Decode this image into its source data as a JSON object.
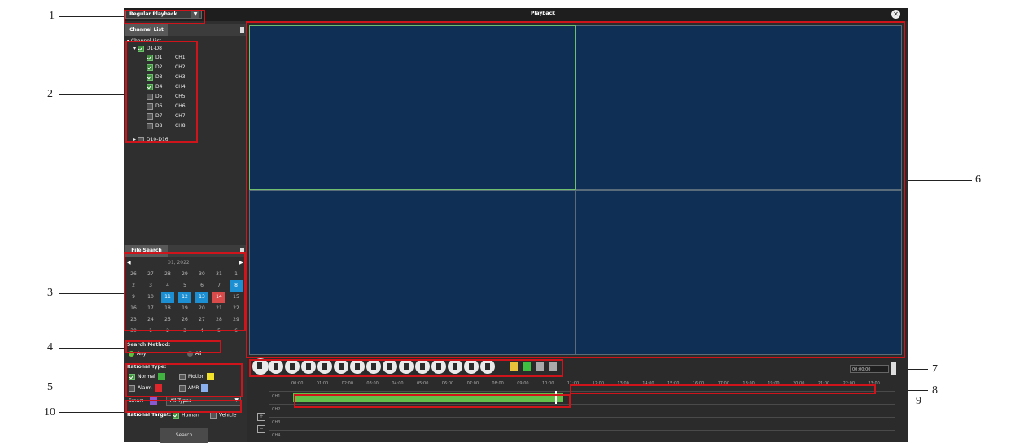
{
  "header": {
    "mode_select": "Regular Playback",
    "title": "Playback",
    "close_icon": "close-icon"
  },
  "sidebar": {
    "channel_tab": "Channel List",
    "tree_root": "Channel List",
    "group_1": "D1-D8",
    "channels": [
      {
        "id": "D1",
        "name": "CH1",
        "checked": true
      },
      {
        "id": "D2",
        "name": "CH2",
        "checked": true
      },
      {
        "id": "D3",
        "name": "CH3",
        "checked": true
      },
      {
        "id": "D4",
        "name": "CH4",
        "checked": true
      },
      {
        "id": "D5",
        "name": "CH5",
        "checked": false
      },
      {
        "id": "D6",
        "name": "CH6",
        "checked": false
      },
      {
        "id": "D7",
        "name": "CH7",
        "checked": false
      },
      {
        "id": "D8",
        "name": "CH8",
        "checked": false
      }
    ],
    "group_2": "D10-D16",
    "file_search_tab": "File Search",
    "calendar": {
      "month_label": "01, 2022",
      "weekdays": [
        "26",
        "27",
        "28",
        "29",
        "30",
        "31",
        "1"
      ],
      "rows": [
        [
          "26",
          "27",
          "28",
          "29",
          "30",
          "31",
          "1"
        ],
        [
          "2",
          "3",
          "4",
          "5",
          "6",
          "7",
          "8"
        ],
        [
          "9",
          "10",
          "11",
          "12",
          "13",
          "14",
          "15"
        ],
        [
          "16",
          "17",
          "18",
          "19",
          "20",
          "21",
          "22"
        ],
        [
          "23",
          "24",
          "25",
          "26",
          "27",
          "28",
          "29"
        ],
        [
          "30",
          "1",
          "2",
          "3",
          "4",
          "5",
          "6"
        ]
      ]
    },
    "search_method_label": "Search Method:",
    "search_method_any": "Any",
    "search_method_all": "All",
    "rational_type_label": "Rational Type:",
    "type_normal": "Normal",
    "type_motion": "Motion",
    "type_alarm": "Alarm",
    "type_amr": "AMR",
    "type_smart": "Smart",
    "type_all_types": "All Types",
    "rational_target_label": "Rational Target:",
    "target_human": "Human",
    "target_vehicle": "Vehicle",
    "search_button": "Search"
  },
  "timeline": {
    "time_display": "00:00:00",
    "ticks": [
      "00:00",
      "01:00",
      "02:00",
      "03:00",
      "04:00",
      "05:00",
      "06:00",
      "07:00",
      "08:00",
      "09:00",
      "10:00",
      "11:00",
      "12:00",
      "13:00",
      "14:00",
      "15:00",
      "16:00",
      "17:00",
      "18:00",
      "19:00",
      "20:00",
      "21:00",
      "22:00",
      "23:00"
    ],
    "channels": [
      "CH1",
      "CH2",
      "CH3",
      "CH4"
    ]
  },
  "callouts": [
    "1",
    "2",
    "3",
    "4",
    "5",
    "6",
    "7",
    "8",
    "9",
    "10"
  ],
  "colors": {
    "accent_blue": "#1b8fd2",
    "record_green": "#62c04a",
    "red_callout": "#d0141c"
  }
}
